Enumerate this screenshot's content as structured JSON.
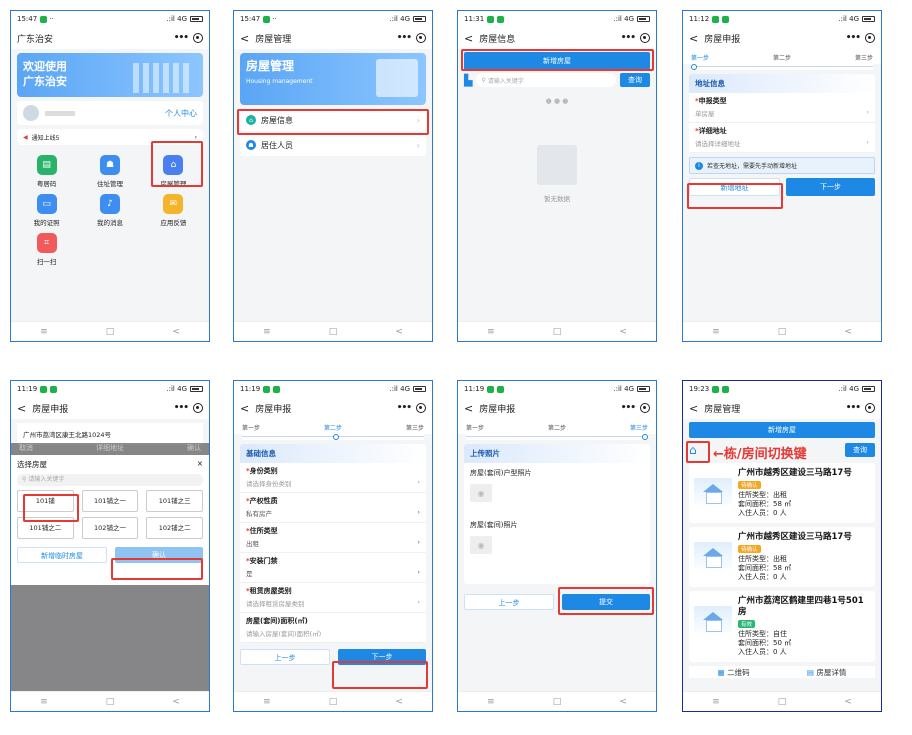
{
  "p1": {
    "time": "15:47",
    "signal": "4G",
    "app_title": "广东治安",
    "banner_line1": "欢迎使用",
    "banner_line2": "广东治安",
    "personal_center": "个人中心",
    "notice": "通知上线5",
    "icons": [
      {
        "label": "粤居码",
        "color": "#29b36a"
      },
      {
        "label": "住址管理",
        "color": "#3d8ef0"
      },
      {
        "label": "房屋管理",
        "color": "#4a7ff0"
      },
      {
        "label": "我的证照",
        "color": "#3d8ef0"
      },
      {
        "label": "我的消息",
        "color": "#3d8ef0"
      },
      {
        "label": "应用反馈",
        "color": "#f5b52b"
      },
      {
        "label": "扫一扫",
        "color": "#f05a5a"
      }
    ]
  },
  "p2": {
    "time": "15:47",
    "signal": "4G",
    "nav_title": "房屋管理",
    "banner_title": "房屋管理",
    "banner_sub": "Housing management",
    "menu_items": [
      "房屋信息",
      "居住人员"
    ]
  },
  "p3": {
    "time": "11:31",
    "signal": "4G",
    "nav_title": "房屋信息",
    "add_button": "新增房屋",
    "search_placeholder": "请输入关键字",
    "query_button": "查询",
    "empty_text": "暂无数据"
  },
  "p4": {
    "time": "11:12",
    "signal": "4G",
    "nav_title": "房屋申报",
    "steps": [
      "第一步",
      "第二步",
      "第三步"
    ],
    "section": "地址信息",
    "fields": [
      {
        "label": "申报类型",
        "value": "单房屋"
      },
      {
        "label": "详细地址",
        "value": "请选择详细地址"
      }
    ],
    "info": "若查无地址，需要先手动新增地址",
    "add_address": "新增地址",
    "next": "下一步"
  },
  "p5": {
    "time": "11:19",
    "signal": "4G",
    "nav_title": "房屋申报",
    "address": "广州市荔湾区康王北路1024号",
    "cancel": "取消",
    "header": "详细地址",
    "confirm_top": "确认",
    "picker_title": "选择房屋",
    "close": "×",
    "search_placeholder": "请输入关键字",
    "rooms": [
      "101铺",
      "101铺之一",
      "101铺之三",
      "101铺之二",
      "102铺之一",
      "102铺之二"
    ],
    "add_temp": "新增临时房屋",
    "confirm": "确认"
  },
  "p6": {
    "time": "11:19",
    "signal": "4G",
    "nav_title": "房屋申报",
    "steps": [
      "第一步",
      "第二步",
      "第三步"
    ],
    "section": "基础信息",
    "fields": [
      {
        "label": "身份类别",
        "value": "请选择身份类别",
        "req": true
      },
      {
        "label": "产权性质",
        "value": "私有房产",
        "req": true
      },
      {
        "label": "住所类型",
        "value": "出租",
        "req": true
      },
      {
        "label": "安装门禁",
        "value": "是",
        "req": true
      },
      {
        "label": "租赁房屋类别",
        "value": "请选择租赁房屋类别",
        "req": true
      },
      {
        "label": "房屋(套间)面积(㎡)",
        "value": "请输入房屋(套间)面积(㎡)",
        "req": false
      }
    ],
    "prev": "上一步",
    "next": "下一步"
  },
  "p7": {
    "time": "11:19",
    "signal": "4G",
    "nav_title": "房屋申报",
    "steps": [
      "第一步",
      "第二步",
      "第三步"
    ],
    "section": "上传照片",
    "photo1": "房屋(套间)户型照片",
    "photo2": "房屋(套间)照片",
    "prev": "上一步",
    "submit": "提交"
  },
  "p8": {
    "time": "19:23",
    "signal": "4G",
    "nav_title": "房屋管理",
    "add_button": "新增房屋",
    "query_button": "查询",
    "annotation": "←栋/房间切换键",
    "houses": [
      {
        "addr": "广州市越秀区建设三马路17号",
        "tag": "待确认",
        "tag_color": "#f5a623",
        "type": "住所类型：出租",
        "area": "套间面积：58 ㎡",
        "people": "入住人员：0 人"
      },
      {
        "addr": "广州市越秀区建设三马路17号",
        "tag": "待确认",
        "tag_color": "#f5a623",
        "type": "住所类型：出租",
        "area": "套间面积：58 ㎡",
        "people": "入住人员：0 人"
      },
      {
        "addr": "广州市荔湾区鹤建里四巷1号501房",
        "tag": "有效",
        "tag_color": "#2bb673",
        "type": "住所类型：自住",
        "area": "套间面积：50 ㎡",
        "people": "入住人员：0 人"
      }
    ],
    "bottom_left": "二维码",
    "bottom_right": "房屋详情"
  },
  "nav_keys": {
    "menu": "≡",
    "home": "□",
    "back": "<"
  }
}
